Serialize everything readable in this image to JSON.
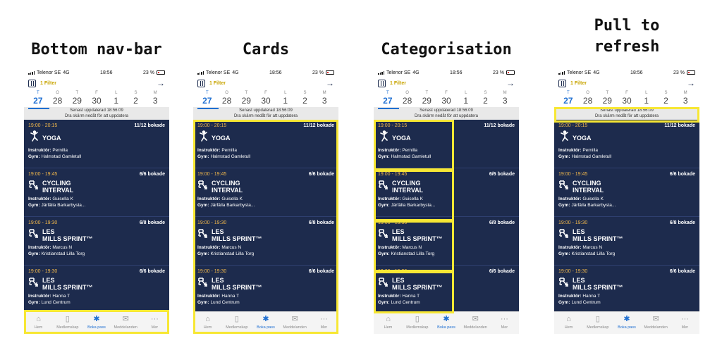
{
  "panels": [
    {
      "title": "Bottom nav-bar"
    },
    {
      "title": "Cards"
    },
    {
      "title": "Categorisation"
    },
    {
      "title": "Pull to\nrefresh"
    }
  ],
  "status": {
    "carrier": "Telenor SE",
    "network": "4G",
    "time": "18:56",
    "battery": "23 %"
  },
  "filter": {
    "label": "1 Filter",
    "arrow": "→"
  },
  "days": [
    {
      "letter": "T",
      "num": "27"
    },
    {
      "letter": "O",
      "num": "28"
    },
    {
      "letter": "T",
      "num": "29"
    },
    {
      "letter": "F",
      "num": "30"
    },
    {
      "letter": "L",
      "num": "1"
    },
    {
      "letter": "S",
      "num": "2"
    },
    {
      "letter": "M",
      "num": "3"
    }
  ],
  "update": {
    "line1": "Senast uppdaterad 18:56:09",
    "line2": "Dra skärm nedåt för att uppdatera"
  },
  "labels": {
    "instructor": "Instruktör:",
    "gym": "Gym:"
  },
  "cards": [
    {
      "time": "19:00 - 20:15",
      "booked": "11/12 bokade",
      "title": "YOGA",
      "instructor": "Pernilla",
      "gym": "Halmstad Gamletull",
      "icon": "yoga-icon"
    },
    {
      "time": "19:00 - 19:45",
      "booked": "6/6 bokade",
      "title": "CYCLING\nINTERVAL",
      "instructor": "Guisella K",
      "gym": "Järfälla Barkarbysta...",
      "icon": "bike-icon"
    },
    {
      "time": "19:00 - 19:30",
      "booked": "6/8 bokade",
      "title": "LES\nMILLS SPRINT™",
      "instructor": "Marcus N",
      "gym": "Kristianstad Lilla Torg",
      "icon": "bike-icon"
    },
    {
      "time": "19:00 - 19:30",
      "booked": "6/6 bokade",
      "title": "LES\nMILLS SPRINT™",
      "instructor": "Hanna T",
      "gym": "Lund Centrum",
      "icon": "bike-icon"
    }
  ],
  "nav": [
    {
      "label": "Hem",
      "icon": "home-icon",
      "glyph": "⌂"
    },
    {
      "label": "Medlemskap",
      "icon": "membership-icon",
      "glyph": "▯"
    },
    {
      "label": "Boka pass",
      "icon": "booking-icon",
      "glyph": "✱"
    },
    {
      "label": "Meddelanden",
      "icon": "mail-icon",
      "glyph": "✉"
    },
    {
      "label": "Mer",
      "icon": "more-icon",
      "glyph": "···"
    }
  ],
  "colors": {
    "navy": "#1d2b4d",
    "highlight": "#f7e734",
    "accent": "#1f6fd1",
    "time": "#f2b84b",
    "filter": "#c8a400"
  }
}
